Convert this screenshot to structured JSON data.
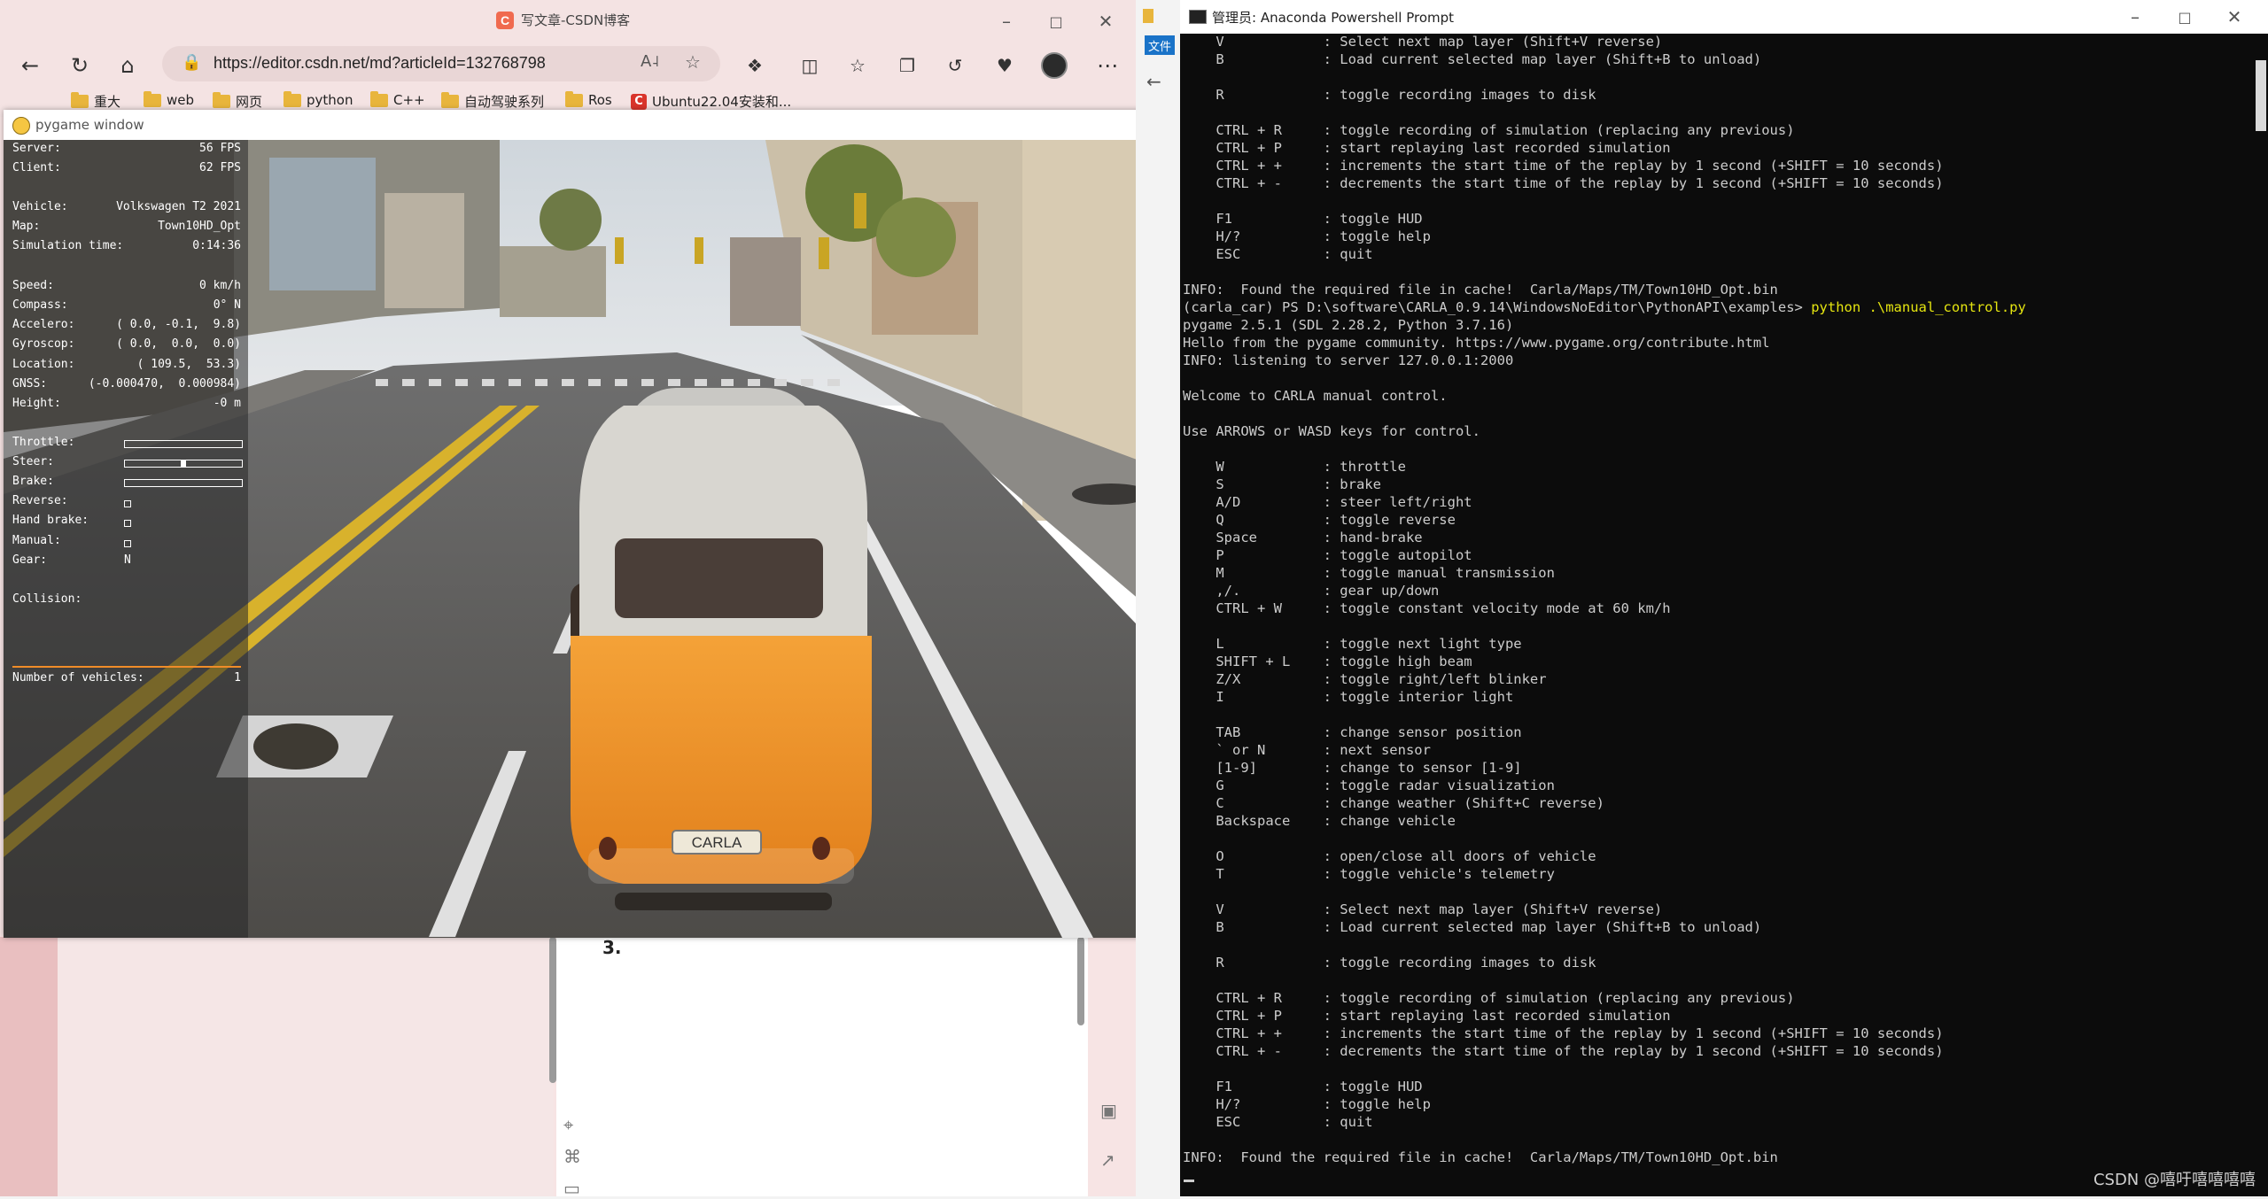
{
  "browser": {
    "tab_title": "写文章-CSDN博客",
    "url": "https://editor.csdn.net/md?articleId=132768798",
    "bookmarks": [
      "重大",
      "web",
      "网页",
      "python",
      "C++",
      "自动驾驶系列",
      "Ros",
      "Ubuntu22.04安装和..."
    ],
    "editor_fragment": "3."
  },
  "pygame": {
    "title": "pygame window",
    "hud": {
      "server_label": "Server:",
      "server_value": "56 FPS",
      "client_label": "Client:",
      "client_value": "62 FPS",
      "vehicle_label": "Vehicle:",
      "vehicle_value": "Volkswagen T2 2021",
      "map_label": "Map:",
      "map_value": "Town10HD_Opt",
      "simtime_label": "Simulation time:",
      "simtime_value": "0:14:36",
      "speed_label": "Speed:",
      "speed_value": "0 km/h",
      "compass_label": "Compass:",
      "compass_value": "0° N",
      "accel_label": "Accelero:",
      "accel_value": "( 0.0, -0.1,  9.8)",
      "gyro_label": "Gyroscop:",
      "gyro_value": "( 0.0,  0.0,  0.0)",
      "location_label": "Location:",
      "location_value": "( 109.5,  53.3)",
      "gnss_label": "GNSS:",
      "gnss_value": "(-0.000470,  0.000984)",
      "height_label": "Height:",
      "height_value": "-0 m",
      "throttle_label": "Throttle:",
      "steer_label": "Steer:",
      "brake_label": "Brake:",
      "reverse_label": "Reverse:",
      "handbrake_label": "Hand brake:",
      "manual_label": "Manual:",
      "gear_label": "Gear:",
      "gear_value": "N",
      "collision_label": "Collision:",
      "vehicles_label": "Number of vehicles:",
      "vehicles_value": "1",
      "throttle": 0.0,
      "steer": 0.5,
      "brake": 0.0
    },
    "plate": "CARLA"
  },
  "terminal": {
    "title": "管理员: Anaconda Powershell Prompt",
    "explorer_tab": "文件",
    "lines": [
      "    V            : Select next map layer (Shift+V reverse)",
      "    B            : Load current selected map layer (Shift+B to unload)",
      "",
      "    R            : toggle recording images to disk",
      "",
      "    CTRL + R     : toggle recording of simulation (replacing any previous)",
      "    CTRL + P     : start replaying last recorded simulation",
      "    CTRL + +     : increments the start time of the replay by 1 second (+SHIFT = 10 seconds)",
      "    CTRL + -     : decrements the start time of the replay by 1 second (+SHIFT = 10 seconds)",
      "",
      "    F1           : toggle HUD",
      "    H/?          : toggle help",
      "    ESC          : quit",
      "",
      "INFO:  Found the required file in cache!  Carla/Maps/TM/Town10HD_Opt.bin",
      "(carla_car) PS D:\\software\\CARLA_0.9.14\\WindowsNoEditor\\PythonAPI\\examples> ",
      "pygame 2.5.1 (SDL 2.28.2, Python 3.7.16)",
      "Hello from the pygame community. https://www.pygame.org/contribute.html",
      "INFO: listening to server 127.0.0.1:2000",
      "",
      "Welcome to CARLA manual control.",
      "",
      "Use ARROWS or WASD keys for control.",
      "",
      "    W            : throttle",
      "    S            : brake",
      "    A/D          : steer left/right",
      "    Q            : toggle reverse",
      "    Space        : hand-brake",
      "    P            : toggle autopilot",
      "    M            : toggle manual transmission",
      "    ,/.          : gear up/down",
      "    CTRL + W     : toggle constant velocity mode at 60 km/h",
      "",
      "    L            : toggle next light type",
      "    SHIFT + L    : toggle high beam",
      "    Z/X          : toggle right/left blinker",
      "    I            : toggle interior light",
      "",
      "    TAB          : change sensor position",
      "    ` or N       : next sensor",
      "    [1-9]        : change to sensor [1-9]",
      "    G            : toggle radar visualization",
      "    C            : change weather (Shift+C reverse)",
      "    Backspace    : change vehicle",
      "",
      "    O            : open/close all doors of vehicle",
      "    T            : toggle vehicle's telemetry",
      "",
      "    V            : Select next map layer (Shift+V reverse)",
      "    B            : Load current selected map layer (Shift+B to unload)",
      "",
      "    R            : toggle recording images to disk",
      "",
      "    CTRL + R     : toggle recording of simulation (replacing any previous)",
      "    CTRL + P     : start replaying last recorded simulation",
      "    CTRL + +     : increments the start time of the replay by 1 second (+SHIFT = 10 seconds)",
      "    CTRL + -     : decrements the start time of the replay by 1 second (+SHIFT = 10 seconds)",
      "",
      "    F1           : toggle HUD",
      "    H/?          : toggle help",
      "    ESC          : quit",
      "",
      "INFO:  Found the required file in cache!  Carla/Maps/TM/Town10HD_Opt.bin"
    ],
    "command_line_index": 15,
    "command": "python .\\manual_control.py",
    "watermark": "CSDN @嘻吁嘻嘻嘻嘻"
  }
}
